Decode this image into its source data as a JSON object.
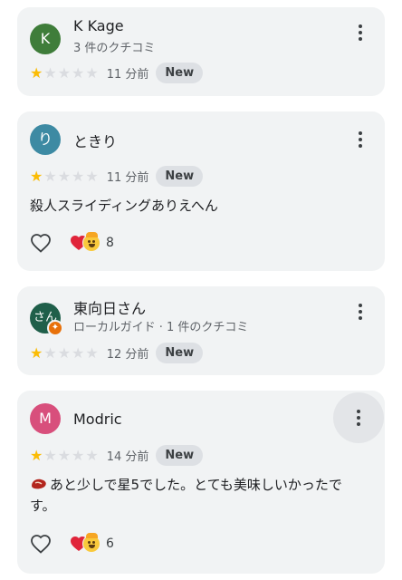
{
  "reviews": [
    {
      "avatar_letter": "K",
      "avatar_color": "#3f7d3a",
      "name": "K Kage",
      "subtitle": "3 件のクチコミ",
      "rating": 1,
      "time": "11 分前",
      "badge": "New",
      "more_icon": "more-vert-icon"
    },
    {
      "avatar_letter": "り",
      "avatar_color": "#3d8aa3",
      "name": "ときり",
      "subtitle": "",
      "rating": 1,
      "time": "11 分前",
      "badge": "New",
      "text": "殺人スライディングありえへん",
      "reaction_count": "8",
      "reaction_icons": [
        "heart-emoji",
        "exploding-head-emoji"
      ],
      "more_icon": "more-vert-icon"
    },
    {
      "avatar_letter": "さん",
      "avatar_color": "#1f5f4a",
      "name": "東向日さん",
      "subtitle": "ローカルガイド · 1 件のクチコミ",
      "rating": 1,
      "time": "12 分前",
      "badge": "New",
      "more_icon": "more-vert-icon"
    },
    {
      "avatar_letter": "M",
      "avatar_color": "#d84f7c",
      "name": "Modric",
      "subtitle": "",
      "rating": 1,
      "time": "14 分前",
      "badge": "New",
      "text": "あと少しで星5でした。とても美味しいかったです。",
      "text_leading_icon": "meat-emoji",
      "reaction_count": "6",
      "reaction_icons": [
        "heart-emoji",
        "exploding-head-emoji"
      ],
      "more_icon": "more-vert-icon"
    }
  ],
  "colors": {
    "star_on": "#fbbc04",
    "star_off": "#dadce0",
    "card_bg": "#f1f3f4"
  }
}
